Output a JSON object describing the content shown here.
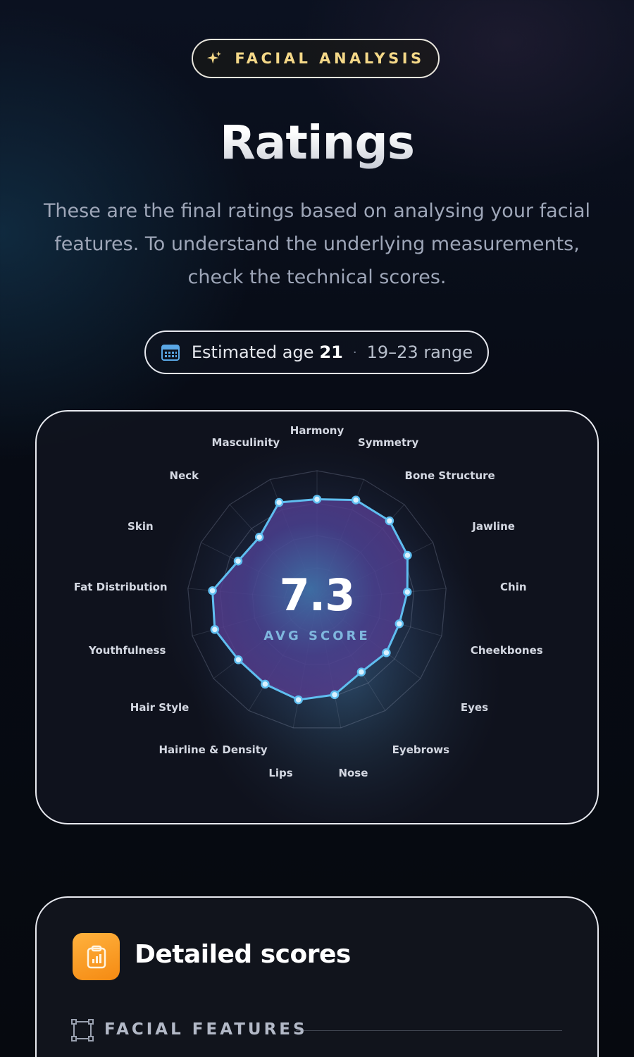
{
  "header": {
    "badge_icon": "sparkle-icon",
    "badge_label": "FACIAL ANALYSIS",
    "badge_color": "#f4d888",
    "title": "Ratings",
    "subtitle": "These are the final ratings based on analysing your facial features. To understand the underlying measurements, check the technical scores."
  },
  "age": {
    "icon": "calendar-icon",
    "label": "Estimated age",
    "value": "21",
    "separator": "·",
    "range": "19–23 range"
  },
  "radar": {
    "score": "7.3",
    "score_label": "AVG SCORE",
    "accent_color": "#5fbef0",
    "axes": [
      {
        "label": "Harmony",
        "value": 7.8
      },
      {
        "label": "Symmetry",
        "value": 8.3
      },
      {
        "label": "Bone Structure",
        "value": 8.3
      },
      {
        "label": "Jawline",
        "value": 7.8
      },
      {
        "label": "Chin",
        "value": 7.0
      },
      {
        "label": "Cheekbones",
        "value": 6.6
      },
      {
        "label": "Eyes",
        "value": 6.7
      },
      {
        "label": "Eyebrows",
        "value": 6.5
      },
      {
        "label": "Nose",
        "value": 7.4
      },
      {
        "label": "Lips",
        "value": 7.8
      },
      {
        "label": "Hairline & Density",
        "value": 7.6
      },
      {
        "label": "Hair Style",
        "value": 7.6
      },
      {
        "label": "Youthfulness",
        "value": 8.2
      },
      {
        "label": "Fat Distribution",
        "value": 8.1
      },
      {
        "label": "Skin",
        "value": 6.8
      },
      {
        "label": "Neck",
        "value": 6.6
      },
      {
        "label": "Masculinity",
        "value": 8.1
      }
    ]
  },
  "detailed": {
    "icon": "clipboard-chart-icon",
    "title": "Detailed scores",
    "section_icon": "face-frame-icon",
    "section_label": "FACIAL FEATURES"
  }
}
